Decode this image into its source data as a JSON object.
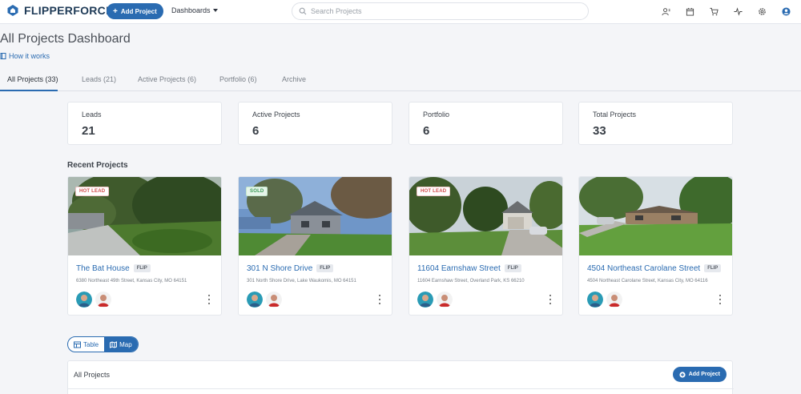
{
  "app": {
    "brand": "FLIPPERFORCE"
  },
  "topbar": {
    "add_project_label": "Add Project",
    "dashboards_label": "Dashboards",
    "search_placeholder": "Search Projects"
  },
  "page": {
    "title": "All Projects Dashboard",
    "how_it_works": "How it works"
  },
  "tabs": [
    {
      "label": "All Projects (33)",
      "active": true
    },
    {
      "label": "Leads (21)"
    },
    {
      "label": "Active Projects (6)"
    },
    {
      "label": "Portfolio (6)"
    },
    {
      "label": "Archive"
    }
  ],
  "stats": [
    {
      "label": "Leads",
      "value": "21"
    },
    {
      "label": "Active Projects",
      "value": "6"
    },
    {
      "label": "Portfolio",
      "value": "6"
    },
    {
      "label": "Total Projects",
      "value": "33"
    }
  ],
  "recent": {
    "title": "Recent Projects",
    "projects": [
      {
        "name": "The Bat House",
        "tag": "FLIP",
        "address": "6380 Northeast 49th Street, Kansas City, MO 64151",
        "badge": "HOT LEAD"
      },
      {
        "name": "301 N Shore Drive",
        "tag": "FLIP",
        "address": "301 North Shore Drive, Lake Waukomis, MO 64151",
        "badge": "SOLD"
      },
      {
        "name": "11604 Earnshaw Street",
        "tag": "FLIP",
        "address": "11604 Earnshaw Street, Overland Park, KS 66210",
        "badge": "HOT LEAD"
      },
      {
        "name": "4504 Northeast Carolane Street",
        "tag": "FLIP",
        "address": "4504 Northeast Carolane Street, Kansas City, MO 64116",
        "badge": ""
      }
    ]
  },
  "view_toggle": {
    "table_label": "Table",
    "map_label": "Map"
  },
  "table": {
    "title": "All Projects",
    "add_label": "Add Project"
  },
  "colors": {
    "accent": "#2a6bb1",
    "hot": "#d24b4b",
    "sold": "#3c9a57"
  }
}
